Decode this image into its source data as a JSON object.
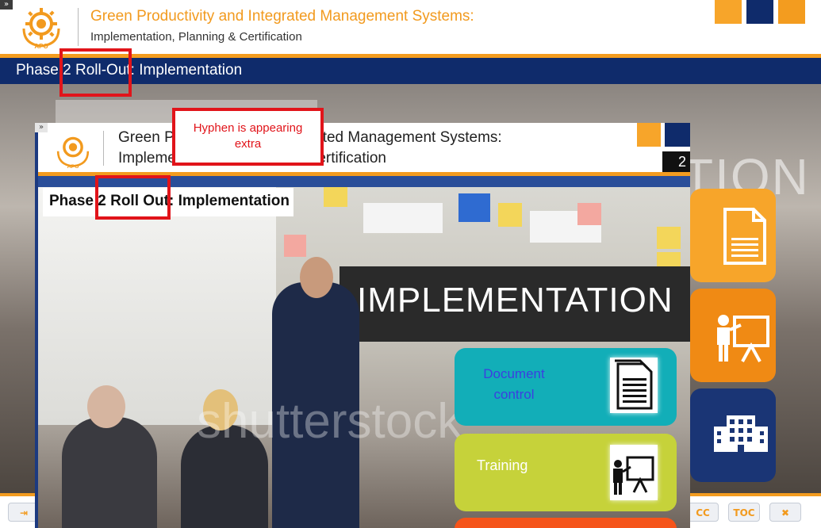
{
  "outer_header": {
    "title": "Green Productivity and Integrated Management Systems:",
    "subtitle": "Implementation, Planning & Certification",
    "logo_text": "APO",
    "collapse_glyph": "»"
  },
  "phase_bar": {
    "label": "Phase 2 Roll-Out: Implementation"
  },
  "background_word": "TION",
  "inner_slide": {
    "title_line1": "Green Productivity and Integrated Management Systems:",
    "title_line2": "Implementation, Planning & Certification",
    "page_number": "2",
    "phase_label": "Phase 2 Roll Out: Implementation",
    "sign_text": "IMPLEMENTATION",
    "watermark": "shutterstock",
    "collapse_glyph": "»"
  },
  "callouts": {
    "document_control": "Document control",
    "training": "Training"
  },
  "annotation": {
    "note": "Hyphen is appearing extra"
  },
  "controls": {
    "exit_icon": "exit-icon",
    "cc_label": "CC",
    "toc_label": "TOC",
    "close_icon": "close-icon"
  },
  "colors": {
    "orange": "#f39c1f",
    "navy": "#0f2b6b",
    "teal": "#12aeb8",
    "lime": "#c6d23a",
    "red_annotation": "#e1141a"
  }
}
